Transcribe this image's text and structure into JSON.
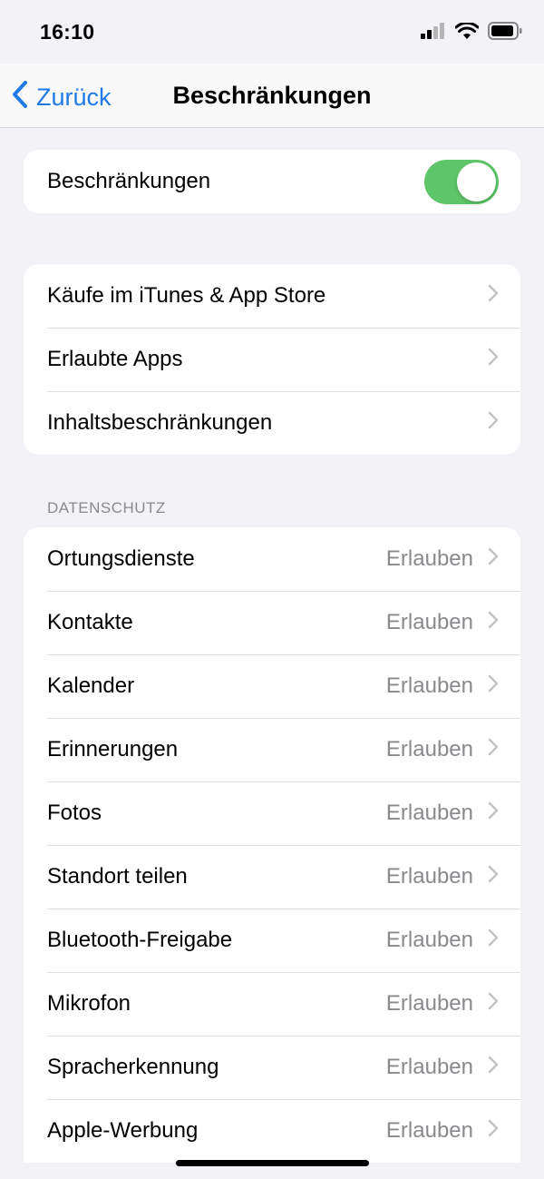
{
  "status_bar": {
    "time": "16:10"
  },
  "nav": {
    "back_label": "Zurück",
    "title": "Beschränkungen"
  },
  "main_toggle": {
    "label": "Beschränkungen",
    "on": true,
    "color": "#5ec569"
  },
  "group_store": {
    "items": [
      {
        "label": "Käufe im iTunes & App Store"
      },
      {
        "label": "Erlaubte Apps"
      },
      {
        "label": "Inhaltsbeschränkungen"
      }
    ]
  },
  "privacy": {
    "header": "DATENSCHUTZ",
    "items": [
      {
        "label": "Ortungsdienste",
        "value": "Erlauben"
      },
      {
        "label": "Kontakte",
        "value": "Erlauben"
      },
      {
        "label": "Kalender",
        "value": "Erlauben"
      },
      {
        "label": "Erinnerungen",
        "value": "Erlauben"
      },
      {
        "label": "Fotos",
        "value": "Erlauben"
      },
      {
        "label": "Standort teilen",
        "value": "Erlauben"
      },
      {
        "label": "Bluetooth-Freigabe",
        "value": "Erlauben"
      },
      {
        "label": "Mikrofon",
        "value": "Erlauben"
      },
      {
        "label": "Spracherkennung",
        "value": "Erlauben"
      },
      {
        "label": "Apple-Werbung",
        "value": "Erlauben"
      }
    ]
  },
  "colors": {
    "accent": "#1f7ae6",
    "background": "#f2f2f7",
    "secondary_text": "#8a8a8e"
  }
}
